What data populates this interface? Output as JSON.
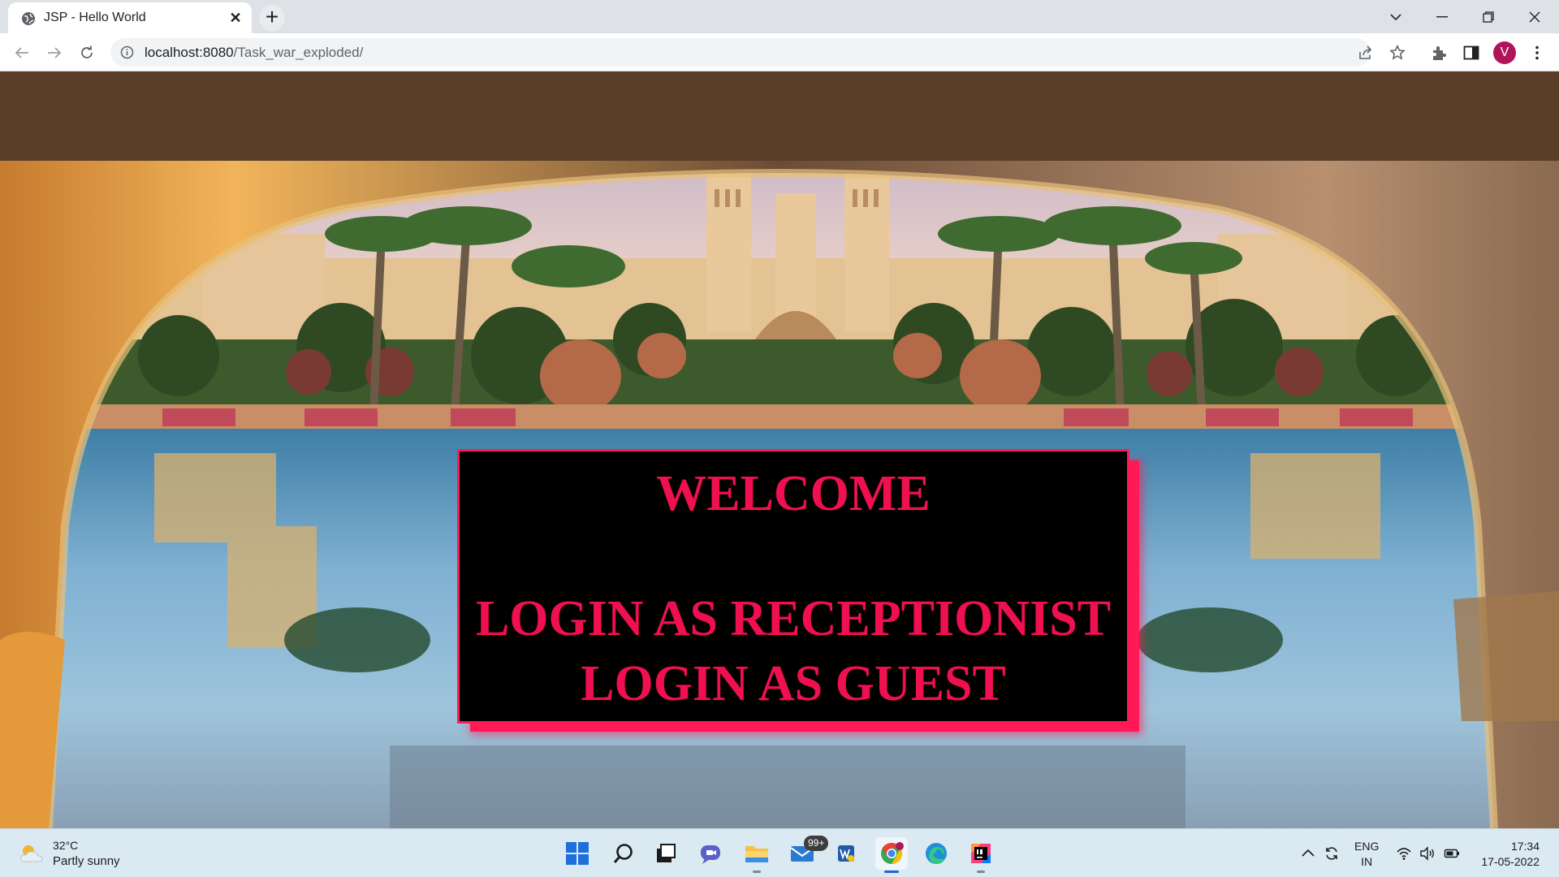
{
  "browser": {
    "tab_title": "JSP - Hello World",
    "url_host": "localhost:8080",
    "url_path": "/Task_war_exploded/",
    "profile_initial": "V"
  },
  "page": {
    "welcome": "WELCOME",
    "login_receptionist": "LOGIN AS RECEPTIONIST",
    "login_guest": "LOGIN AS GUEST",
    "accent_color": "#f0104f"
  },
  "taskbar": {
    "weather_temp": "32°C",
    "weather_desc": "Partly sunny",
    "mail_badge": "99+",
    "lang_line1": "ENG",
    "lang_line2": "IN",
    "time": "17:34",
    "date": "17-05-2022"
  }
}
